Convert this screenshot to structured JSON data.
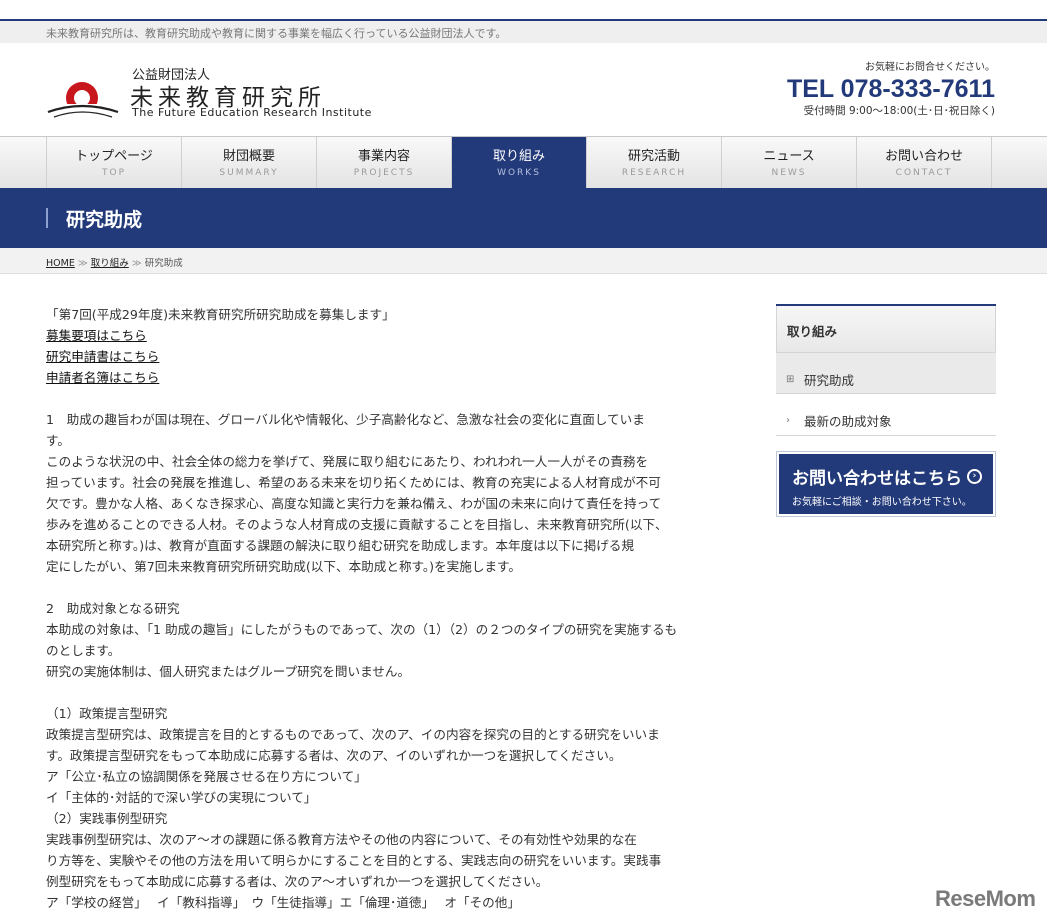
{
  "header": {
    "tagline": "未来教育研究所は、教育研究助成や教育に関する事業を幅広く行っている公益財団法人です。",
    "logo": {
      "small": "公益財団法人",
      "main": "未来教育研究所",
      "english": "The Future Education Research Institute"
    },
    "contact": {
      "note": "お気軽にお問合せください。",
      "tel": "TEL 078-333-7611",
      "hours": "受付時間 9:00～18:00(土･日･祝日除く)"
    }
  },
  "nav": {
    "items": [
      {
        "jp": "トップページ",
        "en": "TOP"
      },
      {
        "jp": "財団概要",
        "en": "SUMMARY"
      },
      {
        "jp": "事業内容",
        "en": "PROJECTS"
      },
      {
        "jp": "取り組み",
        "en": "WORKS"
      },
      {
        "jp": "研究活動",
        "en": "RESEARCH"
      },
      {
        "jp": "ニュース",
        "en": "NEWS"
      },
      {
        "jp": "お問い合わせ",
        "en": "CONTACT"
      }
    ],
    "active": "取り組み"
  },
  "page": {
    "title": "研究助成"
  },
  "breadcrumb": {
    "home": "HOME",
    "parent": "取り組み",
    "current": "研究助成",
    "separator": "≫"
  },
  "content": {
    "announcement": "「第7回(平成29年度)未来教育研究所研究助成を募集します」",
    "links": [
      "募集要項はこちら",
      "研究申請書はこちら",
      "申請者名簿はこちら"
    ],
    "section1": [
      "1　助成の趣旨わが国は現在、グローバル化や情報化、少子高齢化など、急激な社会の変化に直面していま",
      "す。",
      "このような状況の中、社会全体の総力を挙げて、発展に取り組むにあたり、われわれ一人一人がその責務を",
      "担っています。社会の発展を推進し、希望のある未来を切り拓くためには、教育の充実による人材育成が不可",
      "欠です。豊かな人格、あくなき探求心、高度な知識と実行力を兼ね備え、わが国の未来に向けて責任を持って",
      "歩みを進めることのできる人材。そのような人材育成の支援に貢献することを目指し、未来教育研究所(以下、",
      "本研究所と称す。)は、教育が直面する課題の解決に取り組む研究を助成します。本年度は以下に掲げる規",
      "定にしたがい、第7回未来教育研究所研究助成(以下、本助成と称す。)を実施します。"
    ],
    "section2": [
      "2　助成対象となる研究",
      "本助成の対象は、「1 助成の趣旨」にしたがうものであって、次の（1）（2）の２つのタイプの研究を実施するも",
      "のとします。",
      "研究の実施体制は、個人研究またはグループ研究を問いません。"
    ],
    "section3": [
      "（1）政策提言型研究",
      "政策提言型研究は、政策提言を目的とするものであって、次のア、イの内容を探究の目的とする研究をいいま",
      "す。政策提言型研究をもって本助成に応募する者は、次のア、イのいずれか一つを選択してください。",
      "ア「公立･私立の協調関係を発展させる在り方について」",
      "イ「主体的･対話的で深い学びの実現について」",
      "（2）実践事例型研究",
      "実践事例型研究は、次のア～オの課題に係る教育方法やその他の内容について、その有効性や効果的な在",
      "り方等を、実験やその他の方法を用いて明らかにすることを目的とする、実践志向の研究をいいます。実践事",
      "例型研究をもって本助成に応募する者は、次のア～オいずれか一つを選択してください。",
      "ア「学校の経営」　 イ「教科指導」　ウ「生徒指導」エ「倫理･道徳」　 オ「その他」"
    ]
  },
  "sidebar": {
    "heading": "取り組み",
    "items": [
      "研究助成",
      "最新の助成対象"
    ],
    "icons": [
      "square-plus-icon",
      "chevron-right-icon"
    ]
  },
  "cta": {
    "main": "お問い合わせはこちら",
    "sub": "お気軽にご相談・お問い合わせ下さい。"
  },
  "watermark": "ReseMom",
  "colors": {
    "brand_navy": "#233a7a",
    "logo_red": "#c8161d"
  }
}
